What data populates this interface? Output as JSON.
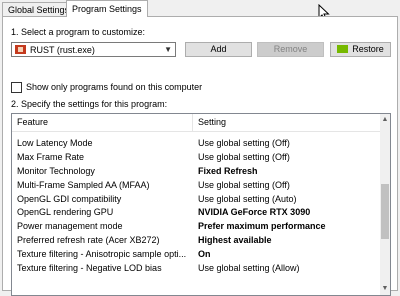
{
  "tabs": [
    {
      "label": "Global Settings"
    },
    {
      "label": "Program Settings"
    }
  ],
  "section1": {
    "label": "1. Select a program to customize:",
    "program_value": "RUST (rust.exe)",
    "add_label": "Add",
    "remove_label": "Remove",
    "restore_label": "Restore"
  },
  "checkbox": {
    "label": "Show only programs found on this computer",
    "checked": false
  },
  "section2": {
    "label": "2. Specify the settings for this program:",
    "columns": {
      "feature": "Feature",
      "setting": "Setting"
    },
    "rows": [
      {
        "feature": "Low Latency Mode",
        "setting": "Use global setting (Off)"
      },
      {
        "feature": "Max Frame Rate",
        "setting": "Use global setting (Off)"
      },
      {
        "feature": "Monitor Technology",
        "setting": "Fixed Refresh"
      },
      {
        "feature": "Multi-Frame Sampled AA (MFAA)",
        "setting": "Use global setting (Off)"
      },
      {
        "feature": "OpenGL GDI compatibility",
        "setting": "Use global setting (Auto)"
      },
      {
        "feature": "OpenGL rendering GPU",
        "setting": "NVIDIA GeForce RTX 3090"
      },
      {
        "feature": "Power management mode",
        "setting": "Prefer maximum performance"
      },
      {
        "feature": "Preferred refresh rate (Acer XB272)",
        "setting": "Highest available"
      },
      {
        "feature": "Texture filtering - Anisotropic sample opti...",
        "setting": "On"
      },
      {
        "feature": "Texture filtering - Negative LOD bias",
        "setting": "Use global setting (Allow)"
      }
    ]
  },
  "icons": {
    "program": "rust-game-icon",
    "restore": "nvidia-logo-icon",
    "cursor": "mouse-pointer-icon"
  },
  "colors": {
    "accent_green": "#76b900",
    "disabled_text": "#838383",
    "panel_bg": "#ffffff",
    "window_bg": "#f0f0f0"
  }
}
